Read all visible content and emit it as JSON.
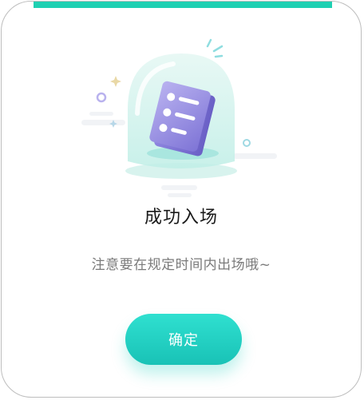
{
  "dialog": {
    "title": "成功入场",
    "message": "注意要在规定时间内出场哦~",
    "confirm_label": "确定"
  },
  "illustration": {
    "icon": "document-under-glass-dome-icon"
  },
  "colors": {
    "accent": "#1fd0b2",
    "button_gradient_top": "#2fe0d0",
    "button_gradient_bottom": "#19c2b6",
    "title_text": "#1a1a1a",
    "message_text": "#7a7a7a"
  }
}
